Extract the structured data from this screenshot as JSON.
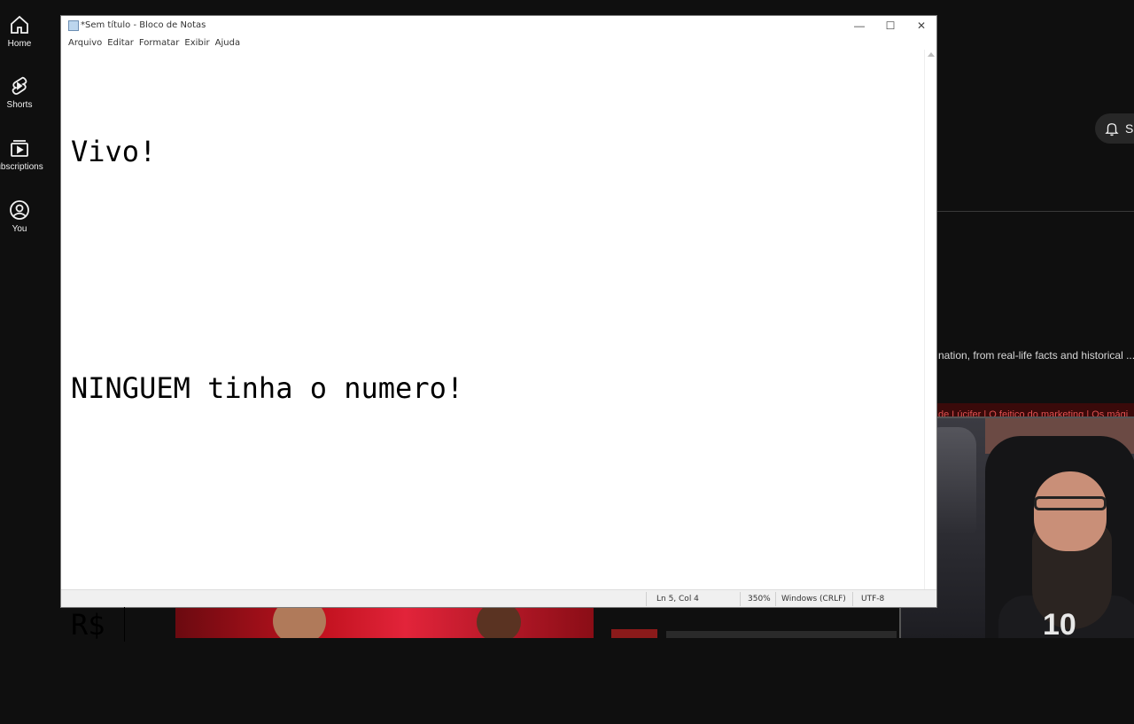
{
  "youtube": {
    "rail": [
      {
        "label": "Home",
        "icon": "home-icon"
      },
      {
        "label": "Shorts",
        "icon": "shorts-icon"
      },
      {
        "label": "ubscriptions",
        "icon": "subscriptions-icon"
      },
      {
        "label": "You",
        "icon": "you-icon"
      }
    ],
    "subscribe_partial": "S",
    "description_snippet": "nation, from real-life facts and historical ...",
    "red_strip_text": "de Lúcifer | O feitiço do marketing | Os mági"
  },
  "webcam": {
    "shirt_number": "10"
  },
  "notepad": {
    "title": "*Sem título - Bloco de Notas",
    "menu": [
      "Arquivo",
      "Editar",
      "Formatar",
      "Exibir",
      "Ajuda"
    ],
    "window_buttons": {
      "minimize": "—",
      "maximize": "☐",
      "close": "✕"
    },
    "lines": [
      "Vivo!",
      "",
      "NINGUEM tinha o numero!",
      "",
      "R$ "
    ],
    "status": {
      "position": "Ln 5, Col 4",
      "zoom": "350%",
      "line_ending": "Windows (CRLF)",
      "encoding": "UTF-8"
    }
  }
}
